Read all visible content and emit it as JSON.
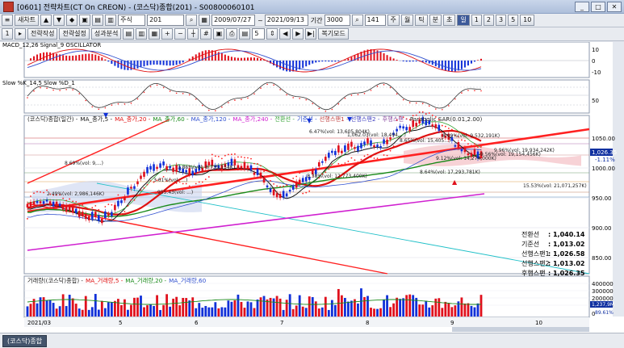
{
  "window": {
    "title": "[0601] 전략차트(CT On CREON) - (코스닥)종합(201) - S00800060101"
  },
  "toolbar1": {
    "new_chart": "새차트",
    "quick_icons": [
      "▲",
      "▼",
      "◆",
      "▣",
      "▤",
      "▥"
    ],
    "symbol_kind": "주식",
    "symbol_code": "201",
    "start_date": "2009/07/27",
    "end_date": "2021/09/13",
    "period_label": "기간",
    "period_value": "3000",
    "count_value": "141",
    "intervals": [
      "주",
      "월",
      "틱",
      "분",
      "초",
      "일",
      "1",
      "2",
      "3",
      "5",
      "10"
    ],
    "selected_interval": "일"
  },
  "toolbar2": {
    "buttons": [
      "전략작성",
      "전략설정",
      "성과분석"
    ],
    "count_value": "5",
    "restore_button": "복기모드"
  },
  "macd": {
    "label": "MACD_12,26 Signal_9 OSCILLATOR",
    "ticks": [
      "10",
      "0",
      "-10"
    ]
  },
  "slow": {
    "label": "Slow %K_14,5 Slow %D_1",
    "ticks": [
      "50"
    ]
  },
  "price": {
    "legend": [
      "(코스닥)종합(일간)",
      "MA_종가,5",
      "MA_종가,20",
      "MA_종가,60",
      "MA_종가,120",
      "MA_종가,240",
      "전환선",
      "기준선",
      "선행스팬1",
      "선행스팬2",
      "후행스팬",
      "Parabolic SAR(0.01,2.00)"
    ],
    "ticks": [
      "1050.00",
      "1000.00",
      "950.00",
      "900.00",
      "850.00"
    ],
    "current_price": "1,026.35",
    "change": "-1.11%",
    "annotations": [
      {
        "text": "6.47%(vol: 13,605,804K)"
      },
      {
        "text": "1,062.03(vol: 18,494,...)"
      },
      {
        "text": "8.99%(vol: 9,532,191K)"
      },
      {
        "text": "8.65%(vol: 15,405...)"
      },
      {
        "text": "9.96%(vol: 19,934,242K)"
      },
      {
        "text": "9.56%(vol: 19,154,456K)"
      },
      {
        "text": "9.12%(vol: 14,274,000K)"
      },
      {
        "text": "8.64%(vol: 17,293,781K)"
      },
      {
        "text": "8.38%(vol: 12,773,400K)"
      },
      {
        "text": "15.53%(vol: 21,071,257K)"
      },
      {
        "text": "8.69%(vol: 9,...)"
      },
      {
        "text": "2.49%(vol: 2,986,146K)"
      },
      {
        "text": "3.86%(vol: 8,735,154K)"
      },
      {
        "text": "3.61%(vol: ...)"
      },
      {
        "text": "955.43(vol: ...)"
      }
    ],
    "info": [
      {
        "label": "전환선",
        "value": ": 1,040.14"
      },
      {
        "label": "기준선",
        "value": ": 1,013.02"
      },
      {
        "label": "선행스팬1",
        "value": ": 1,026.58"
      },
      {
        "label": "선행스팬2",
        "value": ": 1,013.02"
      },
      {
        "label": "후행스팬",
        "value": ": 1,026.35"
      }
    ]
  },
  "volume": {
    "legend": [
      "거래량((코스닥)종합)",
      "MA_거래량,5",
      "MA_거래량,20",
      "MA_거래량,60"
    ],
    "ticks": [
      "400000",
      "300000",
      "200000",
      "100000",
      "0"
    ],
    "current": "1,237,9M",
    "pct": "89.61%"
  },
  "xaxis": {
    "labels": [
      "2021/03",
      "5",
      "6",
      "7",
      "8",
      "9",
      "10"
    ]
  },
  "colors": {
    "up": "#e0101c",
    "down": "#1030d8",
    "sar": "#ff2020",
    "ma20": "#e01010",
    "ma60": "#1a8a1a",
    "ma120": "#2f4fcf",
    "ma240": "#d020d0",
    "cloud": "#f5c7cc",
    "cloud2": "#c9d3ef"
  },
  "status": {
    "tab": "(코스닥)종합"
  }
}
